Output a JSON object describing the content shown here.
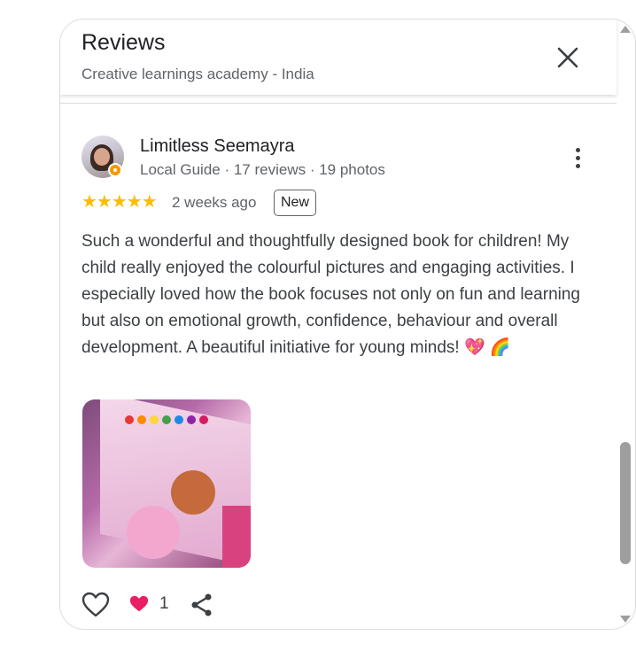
{
  "header": {
    "title": "Reviews",
    "subtitle": "Creative learnings academy - India"
  },
  "review": {
    "reviewer_name": "Limitless Seemayra",
    "reviewer_meta": "Local Guide · 17 reviews · 19 photos",
    "rating": 5,
    "stars": "★★★★★",
    "time": "2 weeks ago",
    "badge": "New",
    "text": "Such a wonderful and thoughtfully designed book for children! My child really enjoyed the colourful pictures and engaging activities. I especially loved how the book focuses not only on fun and learning but also on emotional growth, confidence, behaviour and overall development. A beautiful initiative for young minds! 💖 🌈",
    "reaction_count": "1"
  },
  "icons": {
    "close": "close-icon",
    "more": "more-vert-icon",
    "like": "heart-outline-icon",
    "reaction": "heart-reaction-icon",
    "share": "share-icon"
  },
  "colors": {
    "star": "#fbbc04",
    "reaction": "#e91e63",
    "text": "#3c4043"
  }
}
